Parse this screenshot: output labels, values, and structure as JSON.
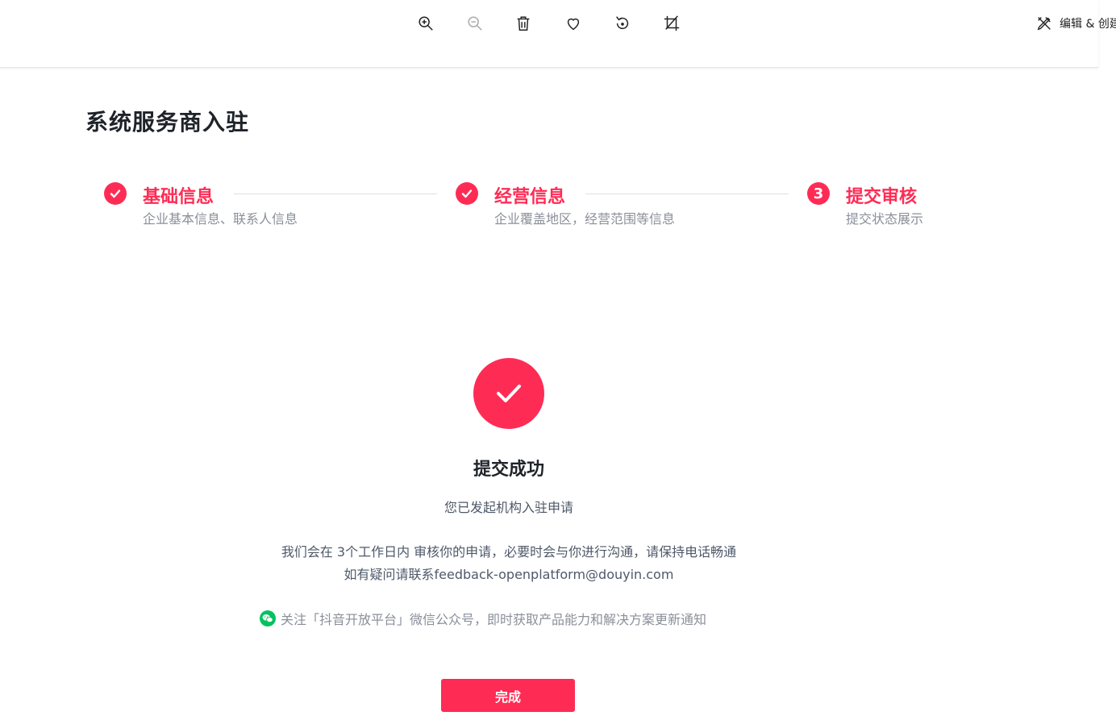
{
  "toolbar": {
    "tools": [
      {
        "name": "zoom-in-icon"
      },
      {
        "name": "zoom-out-icon"
      },
      {
        "name": "trash-icon"
      },
      {
        "name": "heart-icon"
      },
      {
        "name": "rotate-icon"
      },
      {
        "name": "crop-icon"
      }
    ],
    "edit_create_label": "编辑 & 创建"
  },
  "page": {
    "title": "系统服务商入驻"
  },
  "steps": [
    {
      "title": "基础信息",
      "desc": "企业基本信息、联系人信息",
      "status": "done"
    },
    {
      "title": "经营信息",
      "desc": "企业覆盖地区，经营范围等信息",
      "status": "done"
    },
    {
      "title": "提交审核",
      "desc": "提交状态展示",
      "status": "current",
      "number": "3"
    }
  ],
  "result": {
    "title": "提交成功",
    "subtitle": "您已发起机构入驻申请",
    "info_line1": "我们会在 3个工作日内 审核你的申请，必要时会与你进行沟通，请保持电话畅通",
    "info_line2": "如有疑问请联系feedback-openplatform@douyin.com",
    "wechat_text": "关注「抖音开放平台」微信公众号，即时获取产品能力和解决方案更新通知"
  },
  "done_button_label": "完成",
  "colors": {
    "accent": "#fe2c55",
    "wechat": "#07c160"
  }
}
